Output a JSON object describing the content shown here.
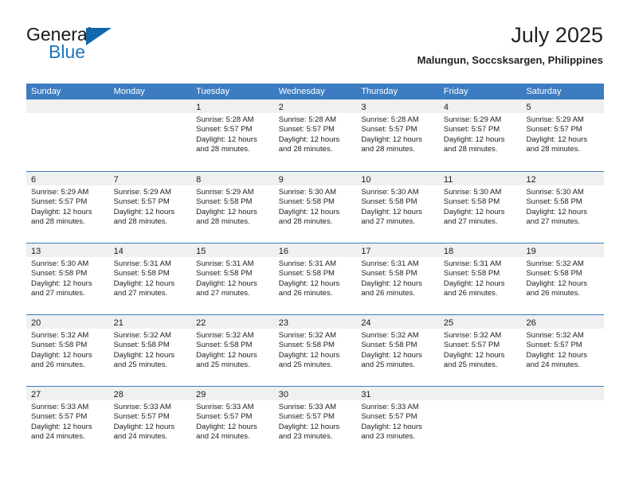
{
  "brand": {
    "word1": "General",
    "word2": "Blue",
    "accent_color": "#1268ad"
  },
  "header": {
    "title": "July 2025",
    "subtitle": "Malungun, Soccsksargen, Philippines"
  },
  "calendar": {
    "header_color": "#3d7cc0",
    "weekdays": [
      "Sunday",
      "Monday",
      "Tuesday",
      "Wednesday",
      "Thursday",
      "Friday",
      "Saturday"
    ],
    "weeks": [
      [
        {
          "day": "",
          "sunrise": "",
          "sunset": "",
          "daylight1": "",
          "daylight2": ""
        },
        {
          "day": "",
          "sunrise": "",
          "sunset": "",
          "daylight1": "",
          "daylight2": ""
        },
        {
          "day": "1",
          "sunrise": "Sunrise: 5:28 AM",
          "sunset": "Sunset: 5:57 PM",
          "daylight1": "Daylight: 12 hours",
          "daylight2": "and 28 minutes."
        },
        {
          "day": "2",
          "sunrise": "Sunrise: 5:28 AM",
          "sunset": "Sunset: 5:57 PM",
          "daylight1": "Daylight: 12 hours",
          "daylight2": "and 28 minutes."
        },
        {
          "day": "3",
          "sunrise": "Sunrise: 5:28 AM",
          "sunset": "Sunset: 5:57 PM",
          "daylight1": "Daylight: 12 hours",
          "daylight2": "and 28 minutes."
        },
        {
          "day": "4",
          "sunrise": "Sunrise: 5:29 AM",
          "sunset": "Sunset: 5:57 PM",
          "daylight1": "Daylight: 12 hours",
          "daylight2": "and 28 minutes."
        },
        {
          "day": "5",
          "sunrise": "Sunrise: 5:29 AM",
          "sunset": "Sunset: 5:57 PM",
          "daylight1": "Daylight: 12 hours",
          "daylight2": "and 28 minutes."
        }
      ],
      [
        {
          "day": "6",
          "sunrise": "Sunrise: 5:29 AM",
          "sunset": "Sunset: 5:57 PM",
          "daylight1": "Daylight: 12 hours",
          "daylight2": "and 28 minutes."
        },
        {
          "day": "7",
          "sunrise": "Sunrise: 5:29 AM",
          "sunset": "Sunset: 5:57 PM",
          "daylight1": "Daylight: 12 hours",
          "daylight2": "and 28 minutes."
        },
        {
          "day": "8",
          "sunrise": "Sunrise: 5:29 AM",
          "sunset": "Sunset: 5:58 PM",
          "daylight1": "Daylight: 12 hours",
          "daylight2": "and 28 minutes."
        },
        {
          "day": "9",
          "sunrise": "Sunrise: 5:30 AM",
          "sunset": "Sunset: 5:58 PM",
          "daylight1": "Daylight: 12 hours",
          "daylight2": "and 28 minutes."
        },
        {
          "day": "10",
          "sunrise": "Sunrise: 5:30 AM",
          "sunset": "Sunset: 5:58 PM",
          "daylight1": "Daylight: 12 hours",
          "daylight2": "and 27 minutes."
        },
        {
          "day": "11",
          "sunrise": "Sunrise: 5:30 AM",
          "sunset": "Sunset: 5:58 PM",
          "daylight1": "Daylight: 12 hours",
          "daylight2": "and 27 minutes."
        },
        {
          "day": "12",
          "sunrise": "Sunrise: 5:30 AM",
          "sunset": "Sunset: 5:58 PM",
          "daylight1": "Daylight: 12 hours",
          "daylight2": "and 27 minutes."
        }
      ],
      [
        {
          "day": "13",
          "sunrise": "Sunrise: 5:30 AM",
          "sunset": "Sunset: 5:58 PM",
          "daylight1": "Daylight: 12 hours",
          "daylight2": "and 27 minutes."
        },
        {
          "day": "14",
          "sunrise": "Sunrise: 5:31 AM",
          "sunset": "Sunset: 5:58 PM",
          "daylight1": "Daylight: 12 hours",
          "daylight2": "and 27 minutes."
        },
        {
          "day": "15",
          "sunrise": "Sunrise: 5:31 AM",
          "sunset": "Sunset: 5:58 PM",
          "daylight1": "Daylight: 12 hours",
          "daylight2": "and 27 minutes."
        },
        {
          "day": "16",
          "sunrise": "Sunrise: 5:31 AM",
          "sunset": "Sunset: 5:58 PM",
          "daylight1": "Daylight: 12 hours",
          "daylight2": "and 26 minutes."
        },
        {
          "day": "17",
          "sunrise": "Sunrise: 5:31 AM",
          "sunset": "Sunset: 5:58 PM",
          "daylight1": "Daylight: 12 hours",
          "daylight2": "and 26 minutes."
        },
        {
          "day": "18",
          "sunrise": "Sunrise: 5:31 AM",
          "sunset": "Sunset: 5:58 PM",
          "daylight1": "Daylight: 12 hours",
          "daylight2": "and 26 minutes."
        },
        {
          "day": "19",
          "sunrise": "Sunrise: 5:32 AM",
          "sunset": "Sunset: 5:58 PM",
          "daylight1": "Daylight: 12 hours",
          "daylight2": "and 26 minutes."
        }
      ],
      [
        {
          "day": "20",
          "sunrise": "Sunrise: 5:32 AM",
          "sunset": "Sunset: 5:58 PM",
          "daylight1": "Daylight: 12 hours",
          "daylight2": "and 26 minutes."
        },
        {
          "day": "21",
          "sunrise": "Sunrise: 5:32 AM",
          "sunset": "Sunset: 5:58 PM",
          "daylight1": "Daylight: 12 hours",
          "daylight2": "and 25 minutes."
        },
        {
          "day": "22",
          "sunrise": "Sunrise: 5:32 AM",
          "sunset": "Sunset: 5:58 PM",
          "daylight1": "Daylight: 12 hours",
          "daylight2": "and 25 minutes."
        },
        {
          "day": "23",
          "sunrise": "Sunrise: 5:32 AM",
          "sunset": "Sunset: 5:58 PM",
          "daylight1": "Daylight: 12 hours",
          "daylight2": "and 25 minutes."
        },
        {
          "day": "24",
          "sunrise": "Sunrise: 5:32 AM",
          "sunset": "Sunset: 5:58 PM",
          "daylight1": "Daylight: 12 hours",
          "daylight2": "and 25 minutes."
        },
        {
          "day": "25",
          "sunrise": "Sunrise: 5:32 AM",
          "sunset": "Sunset: 5:57 PM",
          "daylight1": "Daylight: 12 hours",
          "daylight2": "and 25 minutes."
        },
        {
          "day": "26",
          "sunrise": "Sunrise: 5:32 AM",
          "sunset": "Sunset: 5:57 PM",
          "daylight1": "Daylight: 12 hours",
          "daylight2": "and 24 minutes."
        }
      ],
      [
        {
          "day": "27",
          "sunrise": "Sunrise: 5:33 AM",
          "sunset": "Sunset: 5:57 PM",
          "daylight1": "Daylight: 12 hours",
          "daylight2": "and 24 minutes."
        },
        {
          "day": "28",
          "sunrise": "Sunrise: 5:33 AM",
          "sunset": "Sunset: 5:57 PM",
          "daylight1": "Daylight: 12 hours",
          "daylight2": "and 24 minutes."
        },
        {
          "day": "29",
          "sunrise": "Sunrise: 5:33 AM",
          "sunset": "Sunset: 5:57 PM",
          "daylight1": "Daylight: 12 hours",
          "daylight2": "and 24 minutes."
        },
        {
          "day": "30",
          "sunrise": "Sunrise: 5:33 AM",
          "sunset": "Sunset: 5:57 PM",
          "daylight1": "Daylight: 12 hours",
          "daylight2": "and 23 minutes."
        },
        {
          "day": "31",
          "sunrise": "Sunrise: 5:33 AM",
          "sunset": "Sunset: 5:57 PM",
          "daylight1": "Daylight: 12 hours",
          "daylight2": "and 23 minutes."
        },
        {
          "day": "",
          "sunrise": "",
          "sunset": "",
          "daylight1": "",
          "daylight2": ""
        },
        {
          "day": "",
          "sunrise": "",
          "sunset": "",
          "daylight1": "",
          "daylight2": ""
        }
      ]
    ]
  }
}
